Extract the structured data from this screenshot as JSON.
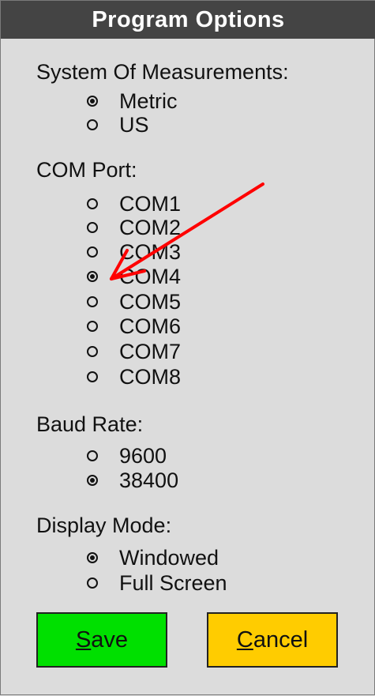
{
  "window": {
    "title": "Program Options"
  },
  "measurements": {
    "label": "System Of Measurements:",
    "options": [
      {
        "label": "Metric",
        "checked": true
      },
      {
        "label": "US",
        "checked": false
      }
    ]
  },
  "com_port": {
    "label": "COM Port:",
    "options": [
      {
        "label": "COM1",
        "checked": false
      },
      {
        "label": "COM2",
        "checked": false
      },
      {
        "label": "COM3",
        "checked": false
      },
      {
        "label": "COM4",
        "checked": true
      },
      {
        "label": "COM5",
        "checked": false
      },
      {
        "label": "COM6",
        "checked": false
      },
      {
        "label": "COM7",
        "checked": false
      },
      {
        "label": "COM8",
        "checked": false
      }
    ]
  },
  "baud_rate": {
    "label": "Baud Rate:",
    "options": [
      {
        "label": "9600",
        "checked": false
      },
      {
        "label": "38400",
        "checked": true
      }
    ]
  },
  "display_mode": {
    "label": "Display Mode:",
    "options": [
      {
        "label": "Windowed",
        "checked": true
      },
      {
        "label": "Full Screen",
        "checked": false
      }
    ]
  },
  "buttons": {
    "save": {
      "mnemonic": "S",
      "rest": "ave",
      "color": "#00e000"
    },
    "cancel": {
      "mnemonic": "C",
      "rest": "ancel",
      "color": "#ffcc00"
    }
  },
  "annotation": {
    "arrow_color": "#ff0000"
  }
}
